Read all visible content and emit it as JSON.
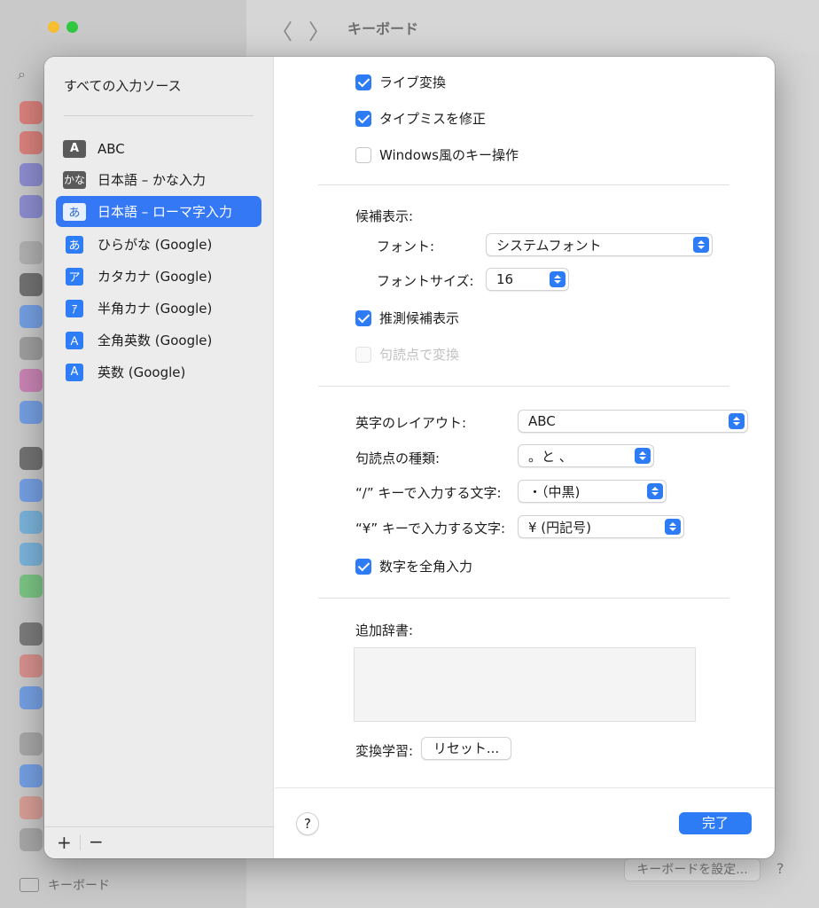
{
  "background": {
    "window_title": "キーボード",
    "nav_back": "〈",
    "nav_forward": "〉",
    "search_icon": "⌕",
    "sidebar_selected_label": "キーボード",
    "setup_button": "キーボードを設定...",
    "help": "?"
  },
  "sidebar": {
    "title": "すべての入力ソース",
    "items": [
      {
        "badge": "A",
        "label": "ABC",
        "icon": "abc-icon"
      },
      {
        "badge": "かな",
        "label": "日本語 – かな入力",
        "icon": "kana-icon"
      },
      {
        "badge": "あ",
        "label": "日本語 – ローマ字入力",
        "icon": "hiragana-icon",
        "selected": true
      },
      {
        "badge": "あ",
        "label": "ひらがな (Google)",
        "icon": "hiragana-icon"
      },
      {
        "badge": "ア",
        "label": "カタカナ (Google)",
        "icon": "katakana-icon"
      },
      {
        "badge": "ｱ",
        "label": "半角カナ (Google)",
        "icon": "halfwidth-katakana-icon"
      },
      {
        "badge": "Ａ",
        "label": "全角英数 (Google)",
        "icon": "fullwidth-alpha-icon"
      },
      {
        "badge": "A",
        "label": "英数 (Google)",
        "icon": "alphanumeric-icon"
      }
    ],
    "add_label": "+",
    "remove_label": "−"
  },
  "options": {
    "live_conversion": {
      "label": "ライブ変換",
      "checked": true
    },
    "typo_correction": {
      "label": "タイプミスを修正",
      "checked": true
    },
    "windows_keys": {
      "label": "Windows風のキー操作",
      "checked": false
    },
    "candidates_heading": "候補表示:",
    "font_label": "フォント:",
    "font_value": "システムフォント",
    "font_size_label": "フォントサイズ:",
    "font_size_value": "16",
    "predictive": {
      "label": "推測候補表示",
      "checked": true
    },
    "punctuation_convert": {
      "label": "句読点で変換",
      "checked": false,
      "disabled": true
    },
    "layout_label": "英字のレイアウト:",
    "layout_value": "ABC",
    "punct_type_label": "句読点の種類:",
    "punct_type_value": "。と 、",
    "slash_label": "“/” キーで入力する文字:",
    "slash_value": "・（中黒)",
    "yen_label": "“¥” キーで入力する文字:",
    "yen_value": "¥ (円記号)",
    "fullwidth_numbers": {
      "label": "数字を全角入力",
      "checked": true
    },
    "dictionary_label": "追加辞書:",
    "learning_label": "変換学習:",
    "reset_label": "リセット..."
  },
  "footer": {
    "help": "?",
    "done": "完了"
  },
  "colors": {
    "accent": "#2d7cf6",
    "selected_row": "#3478f6"
  }
}
